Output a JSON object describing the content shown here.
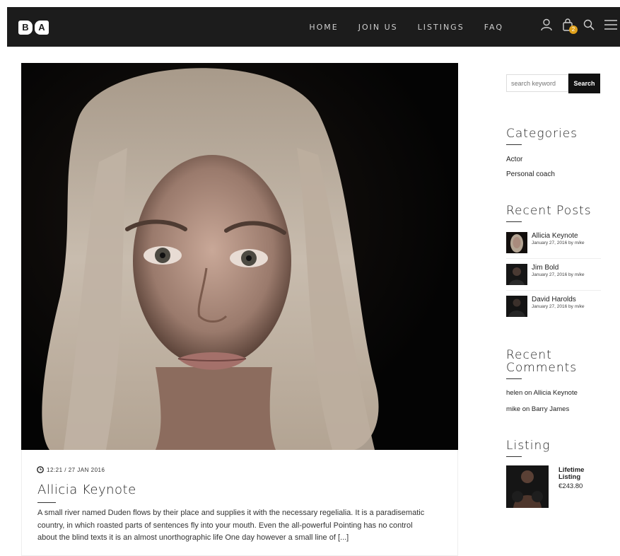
{
  "logo": {
    "b": "B",
    "a": "A"
  },
  "nav": {
    "items": [
      "HOME",
      "JOIN US",
      "LISTINGS",
      "FAQ"
    ],
    "cart_count": "2"
  },
  "post": {
    "meta": "12:21 / 27 JAN 2016",
    "title": "Allicia Keynote",
    "excerpt": "A small river named Duden flows by their place and supplies it with the necessary regelialia. It is a paradisematic country, in which roasted parts of sentences fly into your mouth. Even the all-powerful Pointing has no control about the blind texts it is an almost unorthographic life One day however a small line of [...]"
  },
  "sidebar": {
    "search_placeholder": "search keyword",
    "search_button": "Search",
    "categories_title": "Categories",
    "categories": [
      "Actor",
      "Personal coach"
    ],
    "recent_posts_title": "Recent Posts",
    "recent_posts": [
      {
        "title": "Allicia Keynote",
        "date": "January 27, 2016 by",
        "author": "mike"
      },
      {
        "title": "Jim Bold",
        "date": "January 27, 2016 by",
        "author": "mike"
      },
      {
        "title": "David Harolds",
        "date": "January 27, 2016 by",
        "author": "mike"
      }
    ],
    "recent_comments_title_1": "Recent",
    "recent_comments_title_2": "Comments",
    "comments": [
      "helen on Allicia Keynote",
      "mike on Barry James"
    ],
    "listing_title": "Listing",
    "listing": {
      "name": "Lifetime Listing",
      "price": "€243.80"
    }
  },
  "colors": {
    "topbar": "#1c1c1c",
    "badge": "#e0a11b",
    "accent": "#111111"
  },
  "icons": [
    "user-icon",
    "cart-icon",
    "search-icon",
    "menu-icon",
    "clock-icon"
  ]
}
